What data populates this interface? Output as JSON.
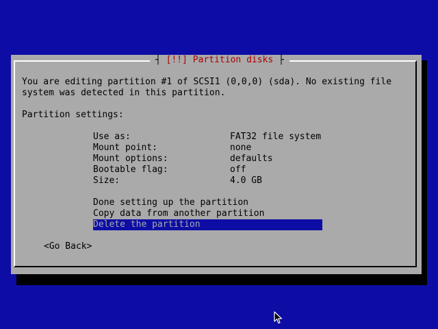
{
  "dialog": {
    "title_marker": "[!!]",
    "title_text": "Partition disks",
    "intro_line1": "You are editing partition #1 of SCSI1 (0,0,0) (sda). No existing file",
    "intro_line2": "system was detected in this partition.",
    "settings_heading": "Partition settings:",
    "settings": [
      {
        "label": "Use as:",
        "value": "FAT32 file system"
      },
      {
        "label": "Mount point:",
        "value": "none"
      },
      {
        "label": "Mount options:",
        "value": "defaults"
      },
      {
        "label": "Bootable flag:",
        "value": "off"
      },
      {
        "label": "Size:",
        "value": "4.0 GB"
      }
    ],
    "actions": [
      {
        "label": "Done setting up the partition",
        "selected": false
      },
      {
        "label": "Copy data from another partition",
        "selected": false
      },
      {
        "label": "Delete the partition",
        "selected": true
      }
    ],
    "go_back_label": "<Go Back>"
  },
  "colors": {
    "background": "#0d0da6",
    "dialog": "#aaaaaa",
    "title_text": "#aa0000",
    "selection": "#0d0da6"
  },
  "icons": {
    "pointer": "mouse-pointer-icon"
  }
}
